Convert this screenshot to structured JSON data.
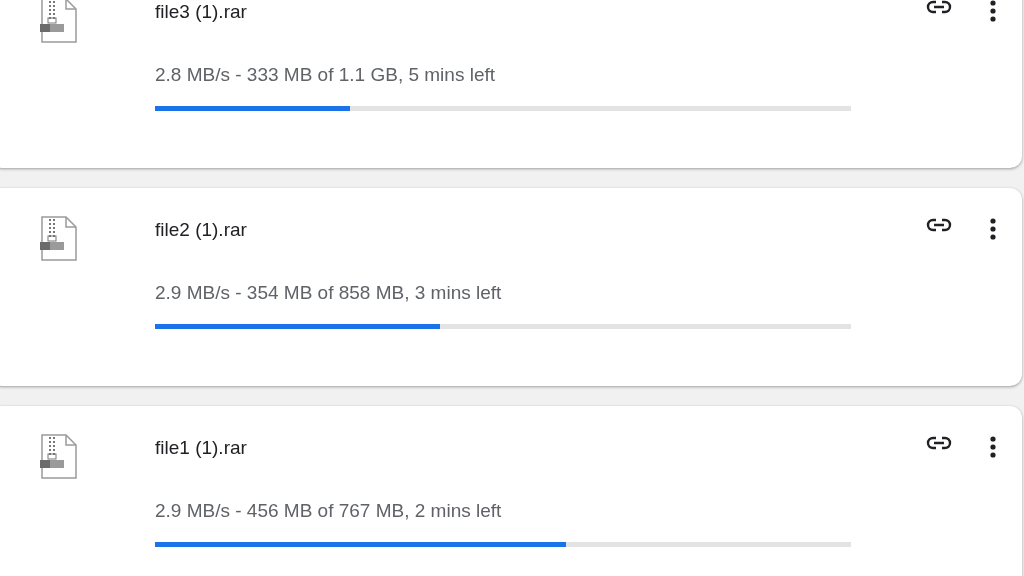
{
  "downloads": [
    {
      "file_name": "file3 (1).rar",
      "status": "2.8 MB/s - 333 MB of 1.1 GB, 5 mins left",
      "level": 0.28
    },
    {
      "file_name": "file2 (1).rar",
      "status": "2.9 MB/s - 354 MB of 858 MB, 3 mins left",
      "level": 0.41
    },
    {
      "file_name": "file1 (1).rar",
      "status": "2.9 MB/s - 456 MB of 767 MB, 2 mins left",
      "level": 0.59
    }
  ]
}
